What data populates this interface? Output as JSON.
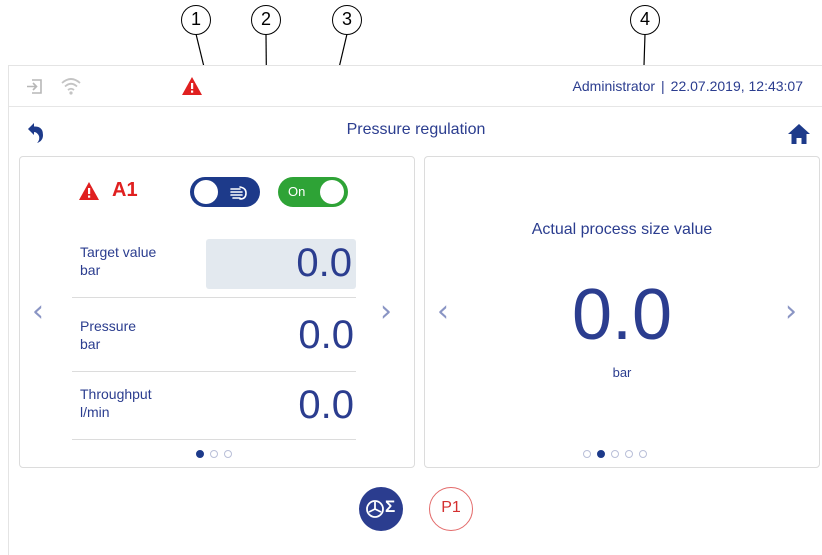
{
  "callouts": [
    "1",
    "2",
    "3",
    "4"
  ],
  "status": {
    "user": "Administrator",
    "separator": "|",
    "datetime": "22.07.2019, 12:43:07"
  },
  "header": {
    "title": "Pressure regulation"
  },
  "left_panel": {
    "alarm_id": "A1",
    "manual_toggle": {
      "state": "on",
      "icon": "hand-icon"
    },
    "power_toggle": {
      "label": "On",
      "state": "on"
    },
    "rows": [
      {
        "label": "Target value",
        "unit": "bar",
        "value": "0.0"
      },
      {
        "label": "Pressure",
        "unit": "bar",
        "value": "0.0"
      },
      {
        "label": "Throughput",
        "unit": "l/min",
        "value": "0.0"
      }
    ],
    "page": 1,
    "page_count": 3
  },
  "right_panel": {
    "title": "Actual process size value",
    "value": "0.0",
    "unit": "bar",
    "page": 2,
    "page_count": 5
  },
  "footer": {
    "p1_label": "P1",
    "sigma_label": "Σ"
  },
  "colors": {
    "accent": "#2b3d8f",
    "toggle_blue": "#1d3a8a",
    "toggle_green": "#2ea336",
    "alarm": "#e02020"
  }
}
